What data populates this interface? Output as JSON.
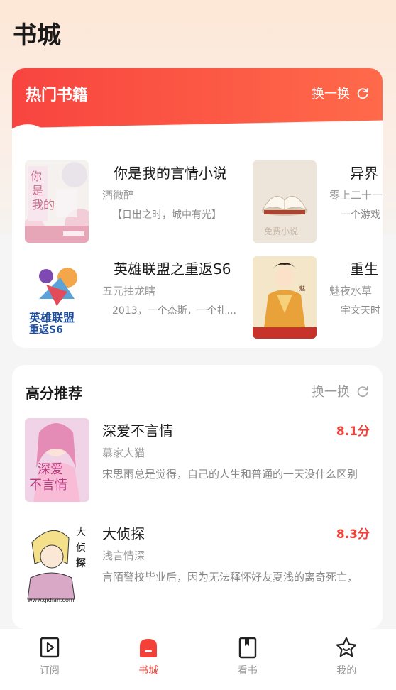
{
  "page": {
    "title": "书城"
  },
  "hot": {
    "title": "热门书籍",
    "refresh_label": "换一换",
    "rows": [
      [
        {
          "title": "你是我的言情小说",
          "author": "酒微醉",
          "desc": "【日出之时，城中有光】",
          "cover": "cover-nishiwode"
        },
        {
          "title": "异界",
          "author": "零上二十一",
          "desc": "一个游戏",
          "cover": "cover-mianfeixiaoshuo"
        }
      ],
      [
        {
          "title": "英雄联盟之重返S6",
          "author": "五元抽龙瞎",
          "desc": "2013，一个杰斯，一个扎...",
          "cover": "cover-lol"
        },
        {
          "title": "重生",
          "author": "魅夜水草",
          "desc": "宇文天时",
          "cover": "cover-chongsheng"
        }
      ]
    ],
    "cover_texts": {
      "nishiwode": "你是我的",
      "mianfei": "免费小说",
      "lol": "英雄联盟之重返S6",
      "lol_sub": "五元抽龙瞎"
    }
  },
  "recommend": {
    "title": "高分推荐",
    "refresh_label": "换一换",
    "items": [
      {
        "title": "深爱不言情",
        "score": "8.1分",
        "author": "慕家大猫",
        "desc": "宋思雨总是觉得，自己的人生和普通的一天没什么区别",
        "cover_text": "深爱不言情"
      },
      {
        "title": "大侦探",
        "score": "8.3分",
        "author": "浅言情深",
        "desc": "言陌警校毕业后，因为无法释怀好友夏浅的离奇死亡，",
        "cover_text": "大侦探",
        "cover_url": "www.qidian.com"
      }
    ]
  },
  "nav": [
    {
      "label": "订阅",
      "icon": "subscribe-icon",
      "active": false
    },
    {
      "label": "书城",
      "icon": "bookstore-icon",
      "active": true
    },
    {
      "label": "看书",
      "icon": "book-icon",
      "active": false
    },
    {
      "label": "我的",
      "icon": "star-icon",
      "active": false
    }
  ],
  "colors": {
    "accent": "#f3413a",
    "hot_header": "#f8443f"
  }
}
